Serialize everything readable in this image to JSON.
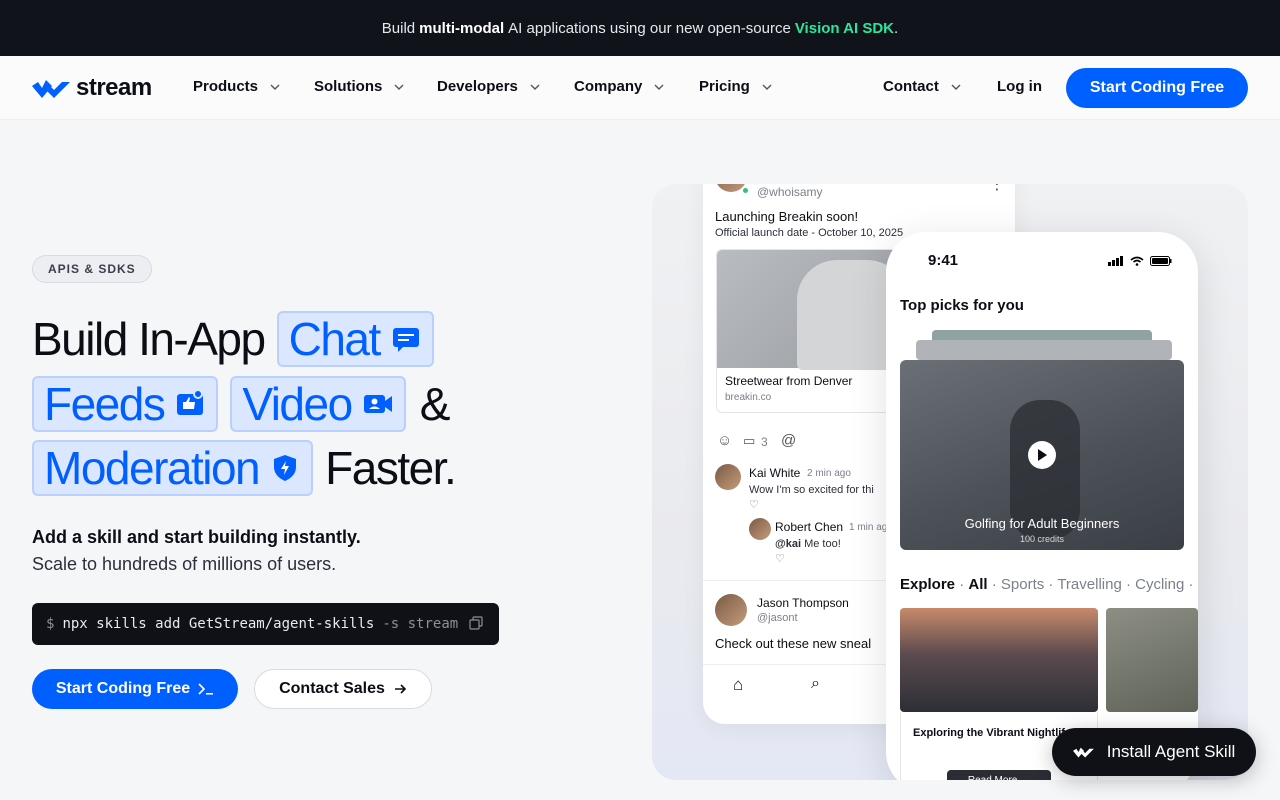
{
  "banner": {
    "prefix": "Build",
    "bold": "multi-modal",
    "middle": "AI applications using our new open-source",
    "sdk": "Vision AI SDK",
    "suffix": "."
  },
  "nav": {
    "logo": "stream",
    "items": [
      {
        "label": "Products"
      },
      {
        "label": "Solutions"
      },
      {
        "label": "Developers"
      },
      {
        "label": "Company"
      },
      {
        "label": "Pricing"
      },
      {
        "label": "Contact"
      }
    ],
    "login": "Log in",
    "cta": "Start Coding Free"
  },
  "hero": {
    "pill": "APIS & SDKS",
    "line1_prefix": "Build In-App",
    "chips": [
      "Chat",
      "Feeds",
      "Video",
      "Moderation"
    ],
    "ampersand": "&",
    "faster": "Faster.",
    "sub1": "Add a skill and start building instantly.",
    "sub2": "Scale to hundreds of millions of users.",
    "command": {
      "prompt": "$",
      "text": "npx skills add GetStream/agent-skills",
      "flag": "-s stream"
    },
    "primary_cta": "Start Coding Free",
    "primary_icon": "terminal-icon",
    "secondary_cta": "Contact Sales",
    "secondary_icon": "arrow-right-icon"
  },
  "feed": {
    "post1": {
      "handle": "@whoisamy",
      "title": "Launching Breakin soon!",
      "sub": "Official launch date - October 10, 2025",
      "link_title": "Streetwear from Denver",
      "link_domain": "breakin.co",
      "comments": "3"
    },
    "comment1": {
      "name": "Kai White",
      "time": "2 min ago",
      "text": "Wow I'm so excited for thi"
    },
    "reply1": {
      "name": "Robert Chen",
      "time": "1 min ag",
      "text_handle": "@kai",
      "text": "Me too!"
    },
    "post2": {
      "name": "Jason Thompson",
      "handle": "@jasont",
      "text": "Check out these new sneal"
    }
  },
  "phone": {
    "time": "9:41",
    "top_picks": "Top picks for you",
    "video_title": "Golfing for Adult Beginners",
    "video_sub": "100 credits",
    "explore_label": "Explore",
    "explore_tabs": [
      "All",
      "Sports",
      "Travelling",
      "Cycling"
    ],
    "article_title": "Exploring the Vibrant Nightlife of Tokyo's Neighborhood",
    "read_more": "Read More →"
  },
  "install": {
    "label": "Install Agent Skill",
    "icon": "stream-logo-icon"
  },
  "colors": {
    "accent": "#005fff",
    "chip_bg": "#dbe7ff",
    "sdk_green": "#2ee59d",
    "dark": "#0f1116"
  }
}
